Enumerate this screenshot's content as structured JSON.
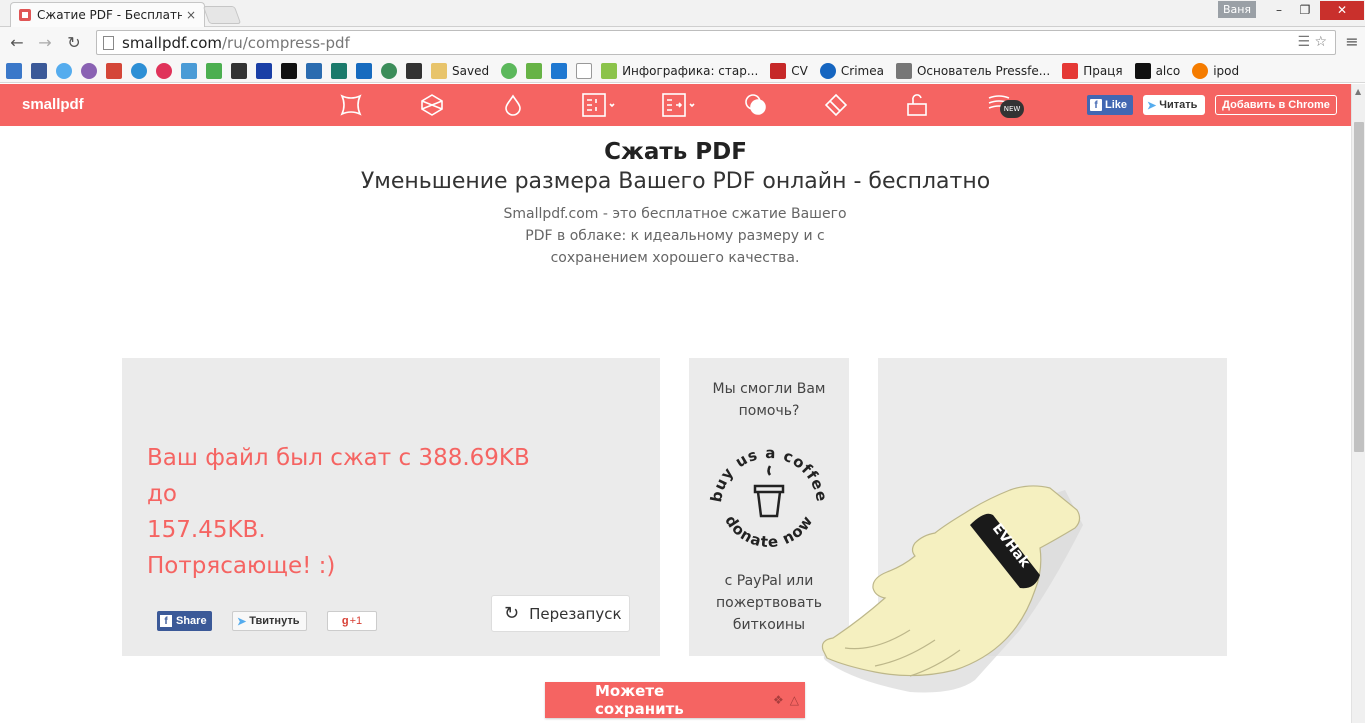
{
  "browser": {
    "tab_title": "Сжатие PDF - Бесплатно",
    "tab_close": "×",
    "user_name": "Ваня",
    "url_host": "smallpdf.com",
    "url_path": "/ru/compress-pdf",
    "bookmarks": [
      {
        "label": "Saved",
        "icon": "folder-icon"
      },
      {
        "label": "Инфографика: стар...",
        "icon": "leaf-icon"
      },
      {
        "label": "CV",
        "icon": "cv-icon"
      },
      {
        "label": "Crimea",
        "icon": "crimea-icon"
      },
      {
        "label": "Основатель Pressfe...",
        "icon": "car-icon"
      },
      {
        "label": "Праця",
        "icon": "praca-icon"
      },
      {
        "label": "alco",
        "icon": "v-icon"
      },
      {
        "label": "ipod",
        "icon": "a-icon"
      }
    ]
  },
  "site": {
    "logo": "smallpdf",
    "tools": [
      "compress-icon",
      "convert-icon",
      "drop-icon",
      "split-icon",
      "merge-icon",
      "toggle-icon",
      "rotate-icon",
      "unlock-icon",
      "new-tool-icon"
    ],
    "new_badge": "NEW",
    "fb_like": "Like",
    "tw_follow": "Читать",
    "add_chrome": "Добавить в Chrome",
    "accent_color": "#f56462"
  },
  "main": {
    "title": "Сжать PDF",
    "subtitle": "Уменьшение размера Вашего PDF онлайн - бесплатно",
    "description": "Smallpdf.com - это бесплатное сжатие Вашего PDF в облаке: к идеальному размеру и с сохранением хорошего качества."
  },
  "result": {
    "line1": "Ваш файл был сжат с 388.69KB до",
    "line2": "157.45KB.",
    "line3": "Потрясающе! :)",
    "share_fb": "Share",
    "share_tw": "Твитнуть",
    "share_gp": "+1",
    "restart": "Перезапуск"
  },
  "donate": {
    "question": "Мы смогли Вам помочь?",
    "coffee_top": "buy us a coffee",
    "coffee_bottom": "donate now",
    "alt": "с PayPal или пожертвовать биткоины"
  },
  "save": {
    "label": "Можете сохранить"
  },
  "overlay": {
    "wristband_text": "EVHak"
  }
}
